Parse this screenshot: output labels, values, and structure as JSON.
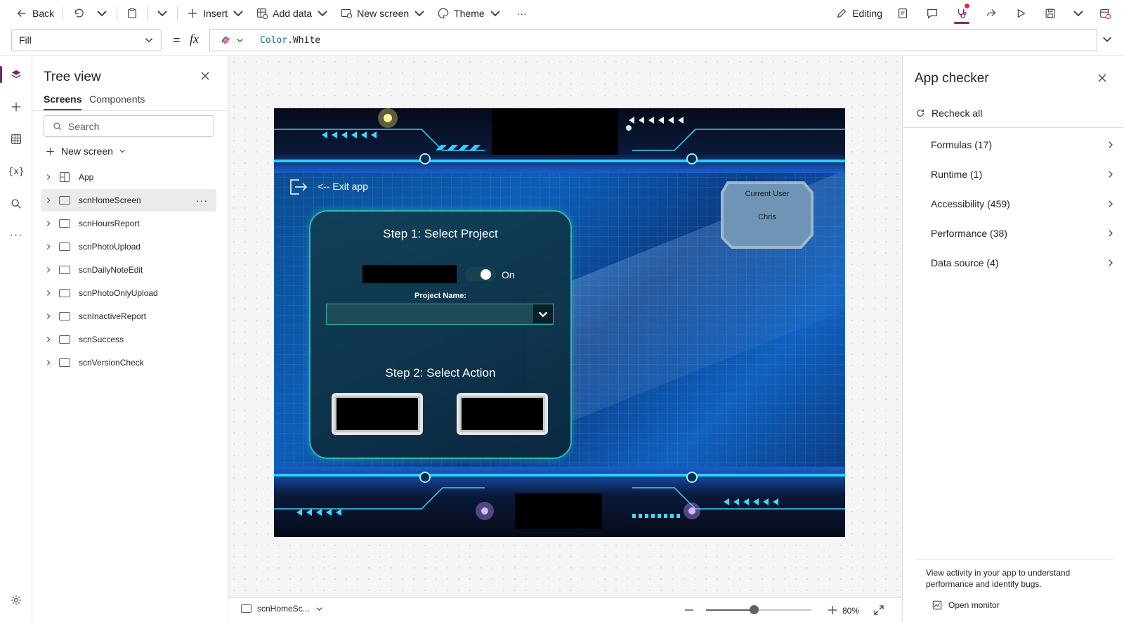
{
  "toolbar": {
    "back_label": "Back",
    "insert_label": "Insert",
    "add_data_label": "Add data",
    "new_screen_label": "New screen",
    "theme_label": "Theme",
    "more_label": "···",
    "editing_label": "Editing"
  },
  "formula_bar": {
    "property": "Fill",
    "equals": "=",
    "fx": "fx",
    "formula_keyword": "Color",
    "formula_rest": ".White"
  },
  "tree": {
    "title": "Tree view",
    "tabs": [
      "Screens",
      "Components"
    ],
    "active_tab": "Screens",
    "search_placeholder": "Search",
    "new_screen_label": "New screen",
    "items": [
      {
        "label": "App",
        "type": "app"
      },
      {
        "label": "scnHomeScreen",
        "type": "screen",
        "selected": true
      },
      {
        "label": "scnHoursReport",
        "type": "screen"
      },
      {
        "label": "scnPhotoUpload",
        "type": "screen"
      },
      {
        "label": "scnDailyNoteEdit",
        "type": "screen"
      },
      {
        "label": "scnPhotoOnlyUpload",
        "type": "screen"
      },
      {
        "label": "scnInactiveReport",
        "type": "screen"
      },
      {
        "label": "scnSuccess",
        "type": "screen"
      },
      {
        "label": "scnVersionCheck",
        "type": "screen"
      }
    ],
    "more_label": "···"
  },
  "app_screen": {
    "exit_label": "<-- Exit app",
    "step1": "Step 1: Select Project",
    "toggle_label": "On",
    "project_name_label": "Project Name:",
    "step2": "Step 2: Select Action",
    "current_user_label": "Current User",
    "user_name": "Chris"
  },
  "checker": {
    "title": "App checker",
    "recheck_label": "Recheck all",
    "categories": [
      {
        "label": "Formulas (17)"
      },
      {
        "label": "Runtime (1)"
      },
      {
        "label": "Accessibility (459)"
      },
      {
        "label": "Performance (38)"
      },
      {
        "label": "Data source (4)"
      }
    ],
    "footer_text": "View activity in your app to understand performance and identify bugs.",
    "open_monitor_label": "Open monitor"
  },
  "bottom": {
    "screen_name": "scnHomeSc...",
    "zoom": "80%",
    "zoom_fraction": 0.45
  },
  "colors": {
    "accent": "#742774",
    "screen_bg": "#0d5fb8",
    "card_border": "#2fb8a8",
    "card_bg": "#123e52"
  }
}
